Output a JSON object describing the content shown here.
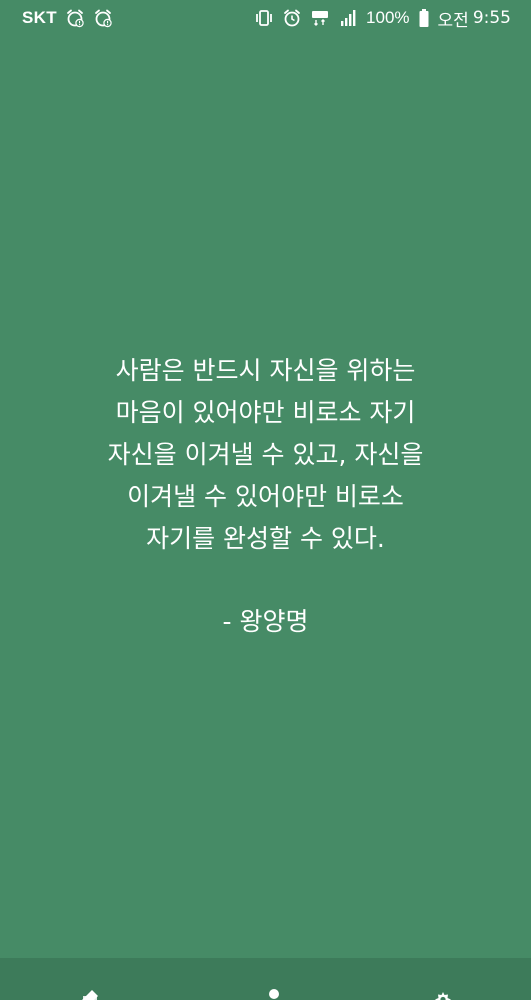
{
  "status_bar": {
    "carrier": "SKT",
    "battery_percent": "100%",
    "ampm": "오전",
    "time": "9:55",
    "icons": [
      "alarm-warning-icon",
      "alarm-warning-icon",
      "vibrate-icon",
      "alarm-clock-icon",
      "lte-icon",
      "signal-icon",
      "battery-icon"
    ]
  },
  "quote": {
    "lines": [
      "사람은 반드시 자신을 위하는",
      "마음이 있어야만 비로소 자기",
      "자신을 이겨낼 수 있고, 자신을",
      "이겨낼 수 있어야만 비로소",
      "자기를 완성할 수 있다."
    ],
    "author": "- 왕양명"
  },
  "bottom_nav": {
    "icons": [
      "edit-icon",
      "person-icon",
      "settings-icon"
    ]
  },
  "colors": {
    "background": "#468b66",
    "nav_background": "#3d7b5a",
    "text": "#ffffff"
  }
}
